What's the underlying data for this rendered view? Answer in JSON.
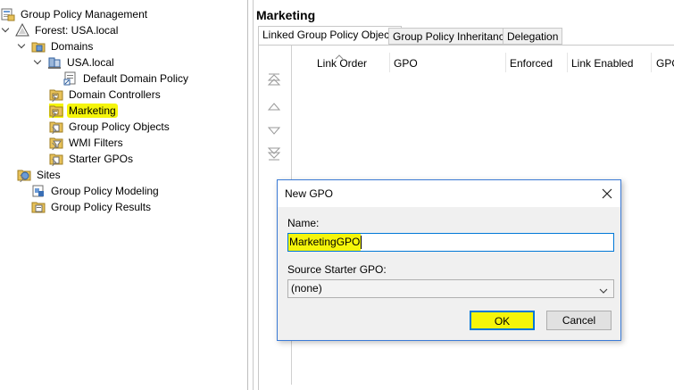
{
  "tree": {
    "root": "Group Policy Management",
    "forest": "Forest: USA.local",
    "domains": "Domains",
    "domain": "USA.local",
    "children": [
      {
        "label": "Default Domain Policy",
        "icon": "gpo-link-icon"
      },
      {
        "label": "Domain Controllers",
        "icon": "ou-folder-icon"
      },
      {
        "label": "Marketing",
        "icon": "ou-folder-icon",
        "highlighted": true
      },
      {
        "label": "Group Policy Objects",
        "icon": "folder-icon"
      },
      {
        "label": "WMI Filters",
        "icon": "filter-folder-icon"
      },
      {
        "label": "Starter GPOs",
        "icon": "folder-icon"
      }
    ],
    "sites": "Sites",
    "modeling": "Group Policy Modeling",
    "results": "Group Policy Results"
  },
  "right": {
    "title": "Marketing",
    "tabs": [
      "Linked Group Policy Objects",
      "Group Policy Inheritance",
      "Delegation"
    ],
    "active_tab": 0,
    "columns": [
      "Link Order",
      "GPO",
      "Enforced",
      "Link Enabled",
      "GPO"
    ]
  },
  "dialog": {
    "title": "New GPO",
    "name_label": "Name:",
    "name_value": "MarketingGPO",
    "source_label": "Source Starter GPO:",
    "source_value": "(none)",
    "ok_label": "OK",
    "cancel_label": "Cancel"
  },
  "colors": {
    "highlight": "#f5f50a",
    "focus_blue": "#0078d7",
    "folder_yellow": "#e8c25a"
  }
}
